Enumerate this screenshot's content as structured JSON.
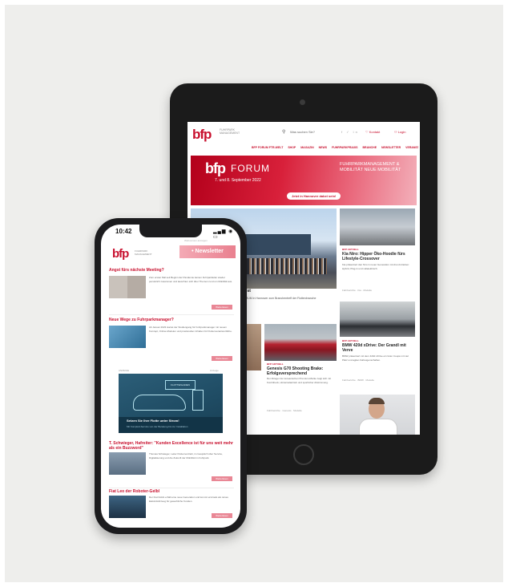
{
  "colors": {
    "brand": "#c8102e",
    "accent_pink": "#e98795",
    "background": "#eeeeec"
  },
  "tablet": {
    "header": {
      "logo": "bfp",
      "logo_sub": "FUHRPARK MANAGEMENT",
      "search_icon": "search-icon",
      "search_label": "Was suchen Sie?",
      "social": "f  ✓  in",
      "kontakt": "♡ Kontakt",
      "login": "⚇ Login"
    },
    "nav": [
      "BFP FORUM FTR-WELT",
      "SHOP",
      "MAGAZIN",
      "NEWS",
      "FUHRPARKPRAXIS",
      "BRANCHE",
      "NEWSLETTER",
      "VERANSTALTUNGEN"
    ],
    "hero": {
      "logo": "bfp",
      "forum": "FORUM",
      "date": "7. und 8. September 2022",
      "right_text": "FUHRPARKMANAGEMENT & MOBILITÄT NEUE MOBILITÄT",
      "button": "Jetzt in Hannover dabei sein!"
    },
    "main_story": {
      "headline": "fest",
      "caption": "Am 7. und 8. September wurde das bfp FORUM in Hannover zum Branchentreff der Flottenbranche"
    },
    "cards": [
      {
        "tag": "BFP AKTUELL",
        "headline": "Kia Niro: Hipper Öko-Hoodie fürs Lifestyle-Crossover",
        "body": "Kia präsentiert den Niro in neuer Generation mit drei Antrieben: Hybrid, Plug-in und vollelektrisch.",
        "meta": "Fahrberichte · Kia · Modelle"
      },
      {
        "tag": "BFP AKTUELL",
        "headline": "Genesis G70 Shooting Brake: Erfolgsversprechend",
        "body": "Der Ableger der koreanischen Premium-Marke zeigt sich mit Kombiheck, Hinterradantrieb und sportlicher Abstimmung.",
        "meta": "Fahrberichte · Genesis · Modelle"
      },
      {
        "tag": "BFP AKTUELL",
        "headline": "BMW 420d xDrive: Der Grandl mit Verve",
        "body": "BMW präsentiert mit dem 420d xDrive ein Gran Coupé mit viel Platz und agilen Fahreigenschaften.",
        "meta": "Fahrberichte · BMW · Modelle"
      }
    ]
  },
  "phone": {
    "time": "10:42",
    "status": "▂▄▆ ◉ ▭",
    "top_line": "Webversion anzeigen",
    "logo": "bfp",
    "logo_sub": "FUHRPARK MANAGEMENT",
    "newsletter": "• Newsletter",
    "sections": [
      {
        "headline": "Angst fürs nächste Meeting?",
        "text": "Zum ersten Mal seit Beginn der Pandemie kamen Fuhrparkleiter wieder persönlich zusammen und tauschten sich über Themen rund um Mobilität aus.",
        "more": "Weiterlesen"
      },
      {
        "headline": "Neue Wege zu Fuhrparkmanager?",
        "text": "Ab Januar 2023 startet der Studiengang für Fuhrparkmanager mit neuem Konzept, Online-Modulen und praxisnahen Inhalten für Flottenverantwortliche.",
        "more": "Weiterlesen"
      },
      {
        "headline": "T. Schwieger, Hafreiter: \"Kunden Excellence ist für uns weit mehr als ein Buzzword\"",
        "text": "Thomas Schwieger, Leiter Flottenvertrieb, im Gespräch über Service, Digitalisierung und die Zukunft der Mobilität im Fuhrpark.",
        "more": "Weiterlesen"
      },
      {
        "headline": "Fiat Leo der Roboter-Gelbl",
        "text": "Der Fiat Doblò erhält eine neue Generation und kommt erstmals als reines Elektrofahrzeug für gewerbliche Kunden.",
        "more": "Weiterlesen"
      }
    ],
    "banner": {
      "tag": "ANZEIGE",
      "ad": "Anzeige",
      "label": "FLOTTENLADEN",
      "title": "Setzen Sie Ihre Flotte unter Strom!",
      "subtitle": "Mit Komplett-Service von der Beratung bis zur Installation"
    }
  }
}
